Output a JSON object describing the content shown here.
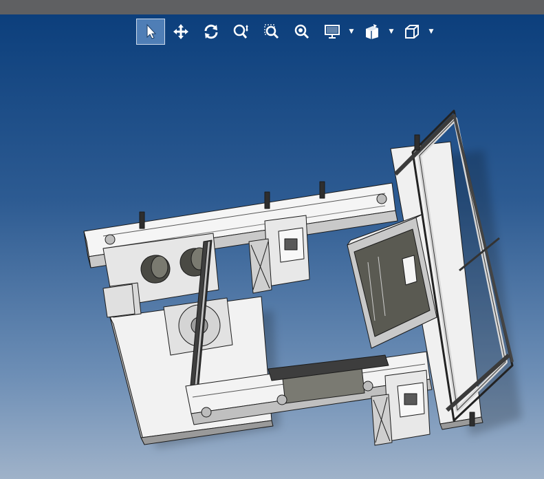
{
  "window": {
    "title": ""
  },
  "toolbar": {
    "tools": [
      {
        "id": "select",
        "icon": "select-arrow-icon",
        "active": true
      },
      {
        "id": "pan",
        "icon": "pan-move-icon",
        "active": false
      },
      {
        "id": "rotate",
        "icon": "rotate-icon",
        "active": false
      },
      {
        "id": "zoom-in-out",
        "icon": "zoom-in-out-icon",
        "active": false
      },
      {
        "id": "zoom-area",
        "icon": "zoom-area-icon",
        "active": false
      },
      {
        "id": "zoom-fit",
        "icon": "zoom-fit-icon",
        "active": false
      },
      {
        "id": "display-style",
        "icon": "display-monitor-icon",
        "dropdown": true
      },
      {
        "id": "section-view",
        "icon": "section-view-icon",
        "dropdown": true
      },
      {
        "id": "view-orientation",
        "icon": "view-cube-icon",
        "dropdown": true
      }
    ]
  },
  "viewport": {
    "background_top": "#0c3f7c",
    "background_bottom": "#9fb2c9",
    "model": "3d-assembly-frame"
  }
}
